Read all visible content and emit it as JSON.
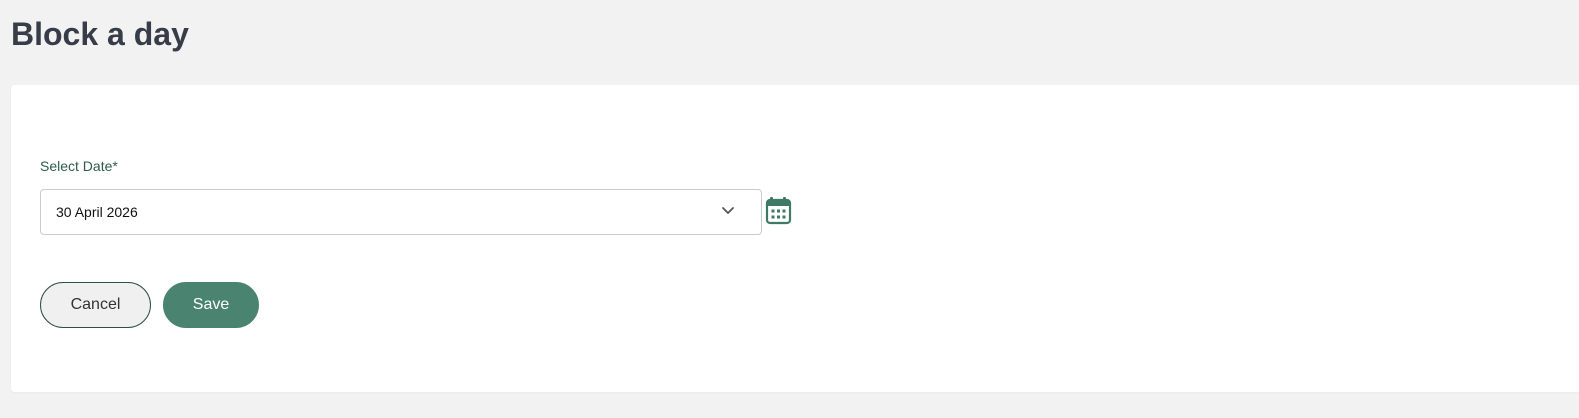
{
  "page": {
    "title": "Block a day"
  },
  "form": {
    "date_label": "Select Date*",
    "date_value": "30 April 2026",
    "calendar_icon": "calendar-icon",
    "dropdown_icon": "chevron-down-icon"
  },
  "actions": {
    "cancel_label": "Cancel",
    "save_label": "Save"
  },
  "colors": {
    "background": "#f2f2f2",
    "title": "#363d48",
    "label": "#2f5b4c",
    "accent": "#4a8470",
    "cancel_border": "#2f4f45"
  }
}
